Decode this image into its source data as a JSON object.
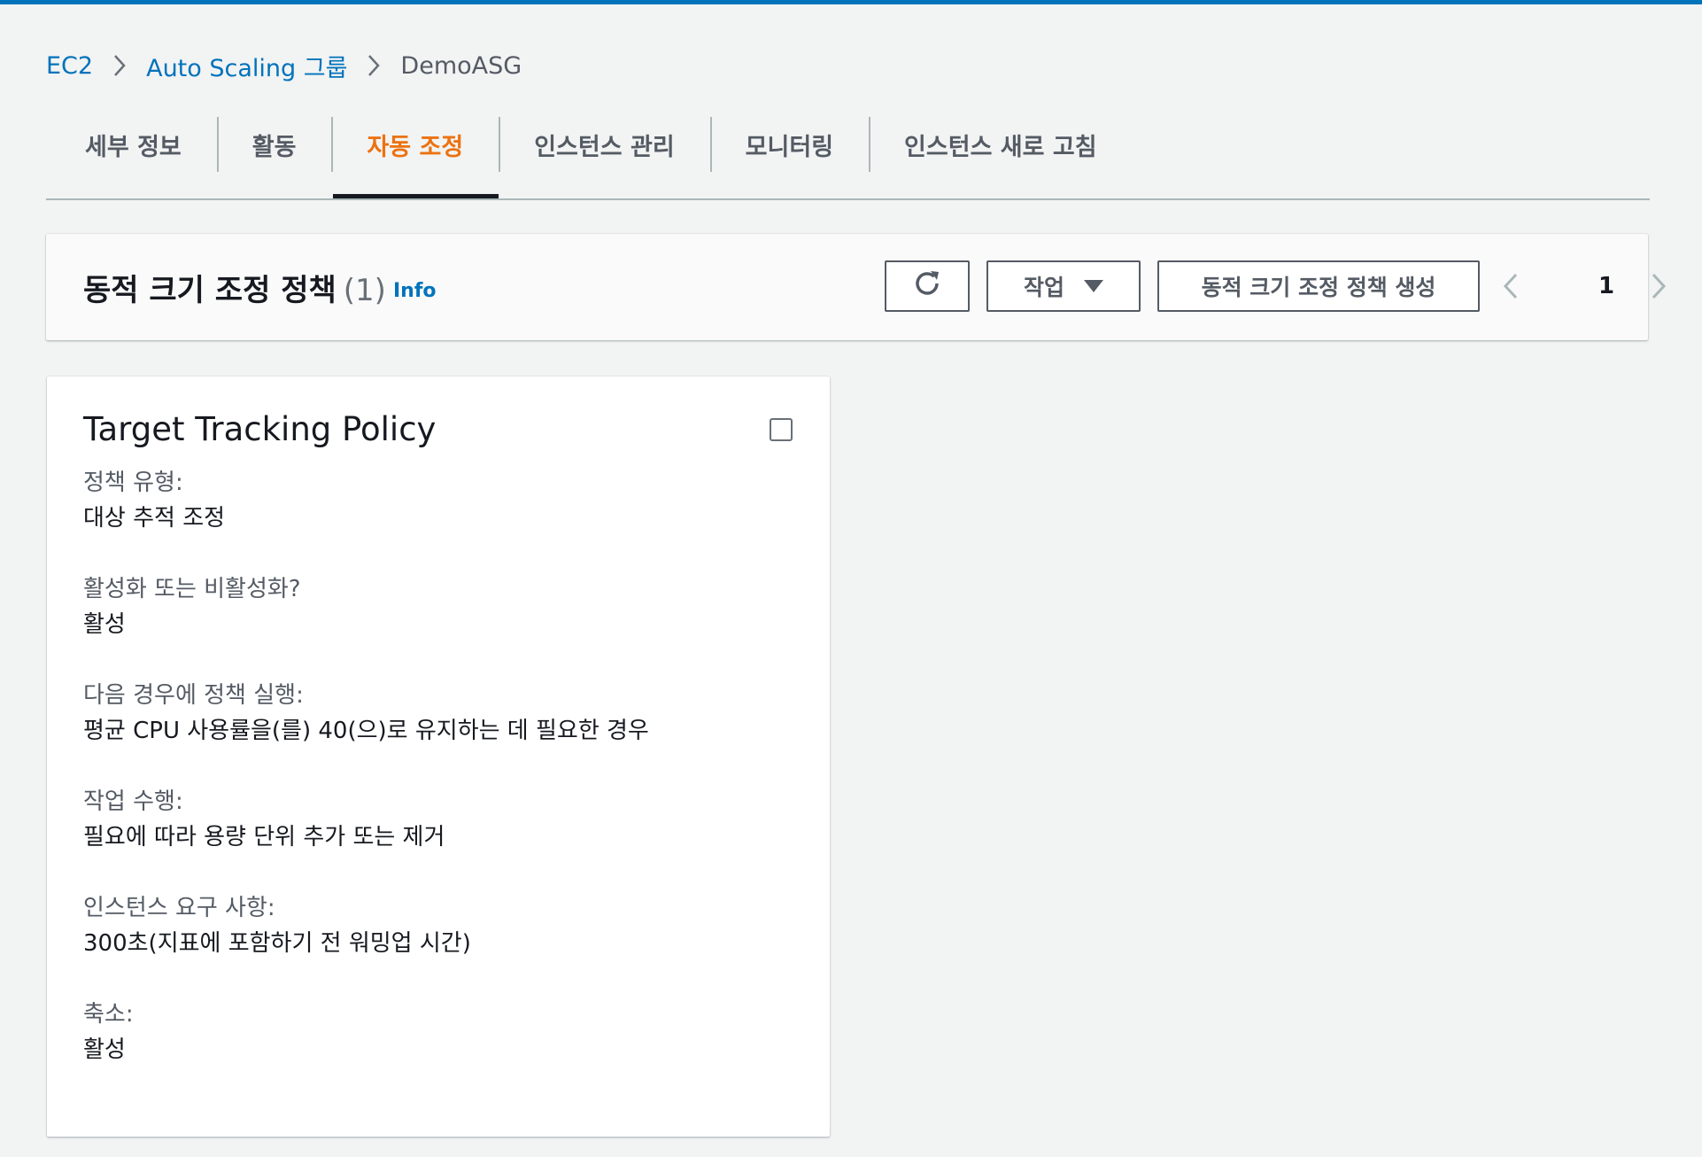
{
  "colors": {
    "accent": "#0073bb",
    "active_tab": "#ec7211",
    "background": "#f2f3f3",
    "text": "#16191f",
    "muted": "#545b64"
  },
  "breadcrumb": {
    "items": [
      {
        "label": "EC2",
        "link": true
      },
      {
        "label": "Auto Scaling 그룹",
        "link": true
      },
      {
        "label": "DemoASG",
        "link": false
      }
    ],
    "separator_icon": "chevron-right-icon"
  },
  "tabs": [
    {
      "label": "세부 정보",
      "active": false
    },
    {
      "label": "활동",
      "active": false
    },
    {
      "label": "자동 조정",
      "active": true
    },
    {
      "label": "인스턴스 관리",
      "active": false
    },
    {
      "label": "모니터링",
      "active": false
    },
    {
      "label": "인스턴스 새로 고침",
      "active": false
    }
  ],
  "panel": {
    "title": "동적 크기 조정 정책",
    "count": "(1)",
    "info_label": "Info",
    "refresh_icon": "refresh-icon",
    "actions_label": "작업",
    "actions_icon": "caret-down-icon",
    "create_label": "동적 크기 조정 정책 생성",
    "pagination": {
      "current_page": "1",
      "prev_icon": "chevron-left-icon",
      "next_icon": "chevron-right-icon"
    }
  },
  "card": {
    "title": "Target Tracking Policy",
    "checked": false,
    "fields": [
      {
        "label": "정책 유형:",
        "value": "대상 추적 조정"
      },
      {
        "label": "활성화 또는 비활성화?",
        "value": "활성"
      },
      {
        "label": "다음 경우에 정책 실행:",
        "value": "평균 CPU 사용률을(를) 40(으)로 유지하는 데 필요한 경우"
      },
      {
        "label": "작업 수행:",
        "value": "필요에 따라 용량 단위 추가 또는 제거"
      },
      {
        "label": "인스턴스 요구 사항:",
        "value": "300초(지표에 포함하기 전 워밍업 시간)"
      },
      {
        "label": "축소:",
        "value": "활성"
      }
    ]
  }
}
